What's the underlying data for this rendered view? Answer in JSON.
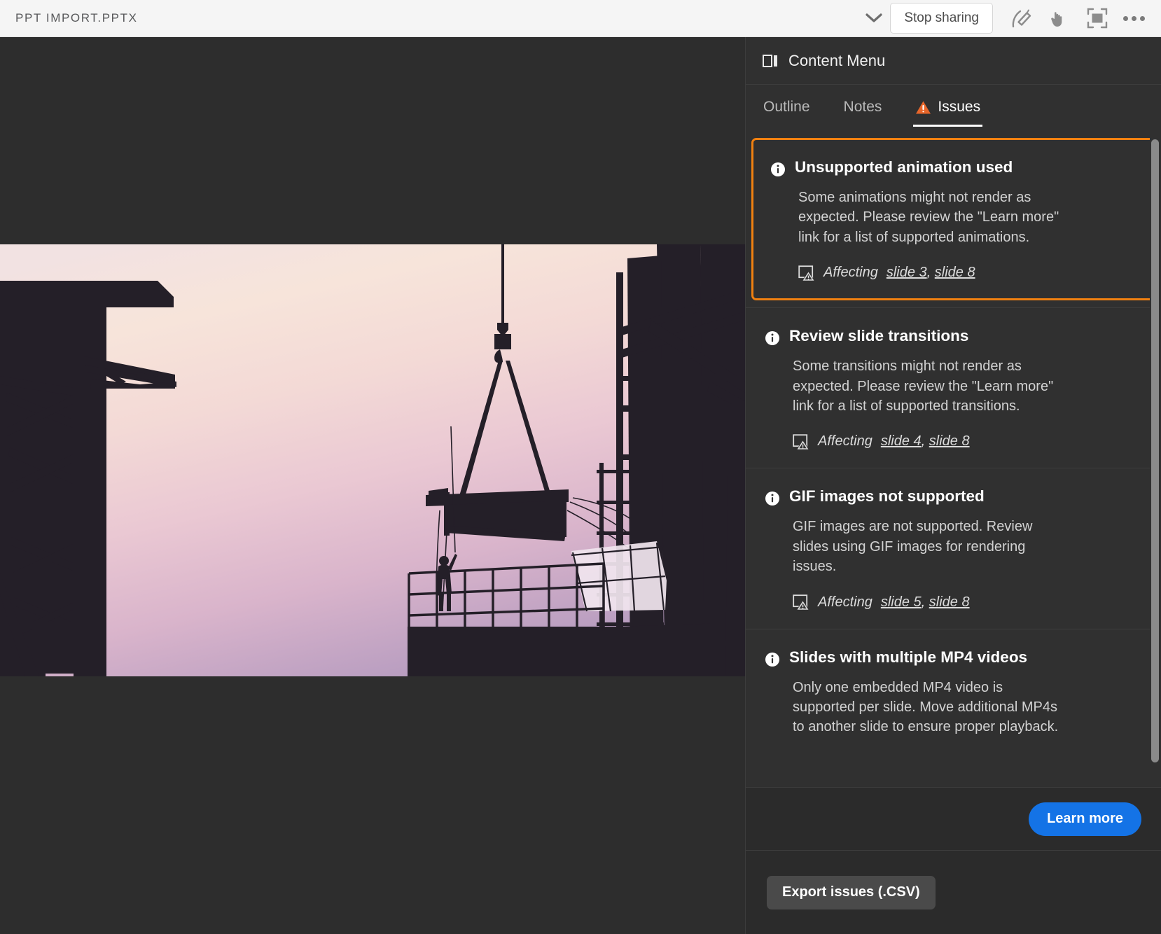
{
  "topbar": {
    "document_title": "PPT IMPORT.PPTX",
    "chevron_icon": "chevron-down-icon",
    "stop_sharing_label": "Stop sharing",
    "tools": [
      {
        "name": "pen-annotate-icon"
      },
      {
        "name": "pointer-hand-icon"
      },
      {
        "name": "fit-to-screen-icon"
      },
      {
        "name": "more-options-icon"
      }
    ]
  },
  "panel": {
    "header_icon": "content-panel-icon",
    "title": "Content Menu",
    "tabs": [
      {
        "label": "Outline",
        "active": false,
        "icon": null
      },
      {
        "label": "Notes",
        "active": false,
        "icon": null
      },
      {
        "label": "Issues",
        "active": true,
        "icon": "warning-triangle-icon"
      }
    ],
    "issues": [
      {
        "icon": "info-circle-icon",
        "title": "Unsupported animation used",
        "description": "Some animations might not render as expected. Please review the \"Learn more\" link for a list of supported animations.",
        "affecting_label": "Affecting",
        "affecting_icon": "slide-warning-icon",
        "slides": [
          "slide 3",
          "slide 8"
        ],
        "highlighted": true
      },
      {
        "icon": "info-circle-icon",
        "title": "Review slide transitions",
        "description": "Some transitions might not render as expected. Please review the \"Learn more\" link for a list of supported transitions.",
        "affecting_label": "Affecting",
        "affecting_icon": "slide-warning-icon",
        "slides": [
          "slide 4",
          "slide 8"
        ],
        "highlighted": false
      },
      {
        "icon": "info-circle-icon",
        "title": "GIF images not supported",
        "description": "GIF images are not supported. Review slides using GIF images for rendering issues.",
        "affecting_label": "Affecting",
        "affecting_icon": "slide-warning-icon",
        "slides": [
          "slide 5",
          "slide 8"
        ],
        "highlighted": false
      },
      {
        "icon": "info-circle-icon",
        "title": "Slides with multiple MP4 videos",
        "description": "Only one embedded MP4 video is supported per slide. Move additional MP4s to another slide to ensure proper playback.",
        "affecting_label": null,
        "affecting_icon": null,
        "slides": [],
        "highlighted": false
      }
    ],
    "learn_more_label": "Learn more",
    "export_label": "Export issues (.CSV)"
  },
  "colors": {
    "accent_highlight": "#F08010",
    "primary_button": "#1473E6",
    "warning": "#E8662A",
    "panel_bg": "#303030",
    "topbar_bg": "#F5F5F5"
  },
  "slide": {
    "image_alt": "construction-site-silhouette-at-dusk"
  }
}
